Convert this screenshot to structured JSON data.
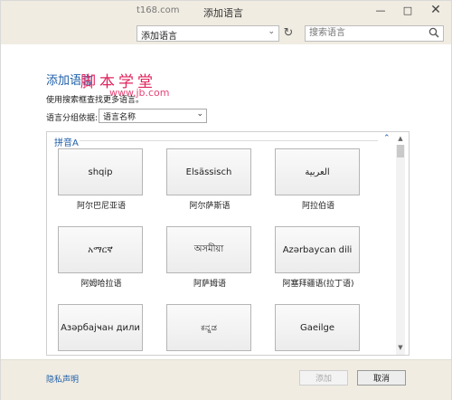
{
  "window": {
    "watermark": "t168.com",
    "title": "添加语言",
    "minimize_glyph": "—",
    "maximize_glyph": "□",
    "close_glyph": "✕"
  },
  "address": {
    "path": "添加语言",
    "chevron": "⌄",
    "refresh_glyph": "↻"
  },
  "search": {
    "placeholder": "搜索语言"
  },
  "brand": {
    "watermark": "脚本学堂",
    "url": "www.jb.com"
  },
  "main": {
    "title": "添加语言",
    "description": "使用搜索框查找更多语言。",
    "group_label": "语言分组依据:",
    "group_select_value": "语言名称",
    "group_select_chevron": "⌄"
  },
  "list": {
    "section_header": "拼音A",
    "collapse_glyph": "⌃",
    "scroll_up_glyph": "▲",
    "scroll_down_glyph": "▼",
    "tiles": [
      {
        "native": "shqip",
        "name": "阿尔巴尼亚语"
      },
      {
        "native": "Elsässisch",
        "name": "阿尔萨斯语"
      },
      {
        "native": "العربية",
        "name": "阿拉伯语"
      },
      {
        "native": "አማርኛ",
        "name": "阿姆哈拉语"
      },
      {
        "native": "অসমীয়া",
        "name": "阿萨姆语"
      },
      {
        "native": "Azərbaycan dili",
        "name": "阿塞拜疆语(拉丁语)"
      },
      {
        "native": "Азәрбајҹан дили",
        "name": ""
      },
      {
        "native": "ಕನ್ನಡ",
        "name": ""
      },
      {
        "native": "Gaeilge",
        "name": ""
      }
    ]
  },
  "footer": {
    "privacy_link": "隐私声明",
    "add_button": "添加",
    "cancel_button": "取消"
  },
  "colors": {
    "accent": "#1f5fa8",
    "watermark": "#e0245e",
    "chrome": "#f0ece2"
  }
}
